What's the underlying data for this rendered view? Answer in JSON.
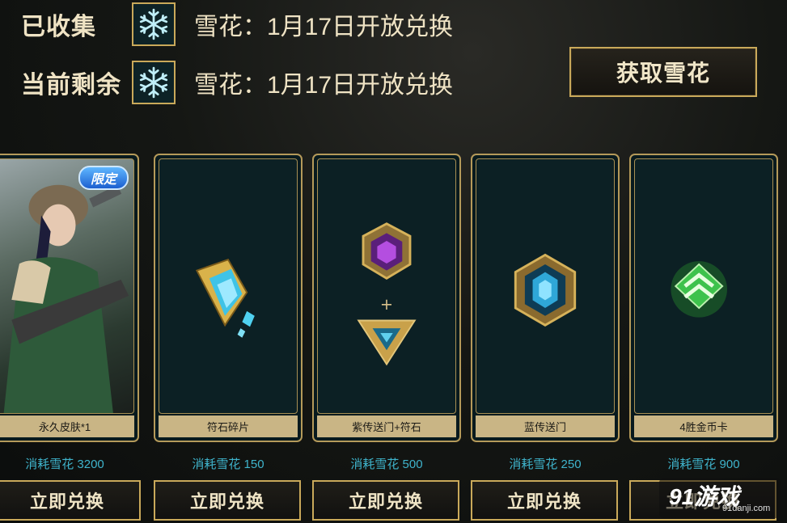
{
  "header": {
    "collected_label": "已收集",
    "remaining_label": "当前剩余",
    "collected_text": "雪花：1月17日开放兑换",
    "remaining_text": "雪花：1月17日开放兑换",
    "snow_icon": "snowflake-icon",
    "get_button_label": "获取雪花"
  },
  "cards": [
    {
      "name": "永久皮肤*1",
      "cost": "消耗雪花 3200",
      "button": "立即兑换",
      "badge": "限定",
      "icon": "skin-portrait"
    },
    {
      "name": "符石碎片",
      "cost": "消耗雪花 150",
      "button": "立即兑换",
      "icon": "rune-shard-icon"
    },
    {
      "name": "紫传送门+符石",
      "cost": "消耗雪花 500",
      "button": "立即兑换",
      "icon": "purple-portal-icon"
    },
    {
      "name": "蓝传送门",
      "cost": "消耗雪花 250",
      "button": "立即兑换",
      "icon": "blue-portal-icon"
    },
    {
      "name": "4胜金币卡",
      "cost": "消耗雪花 900",
      "button": "立即兑换",
      "icon": "gold-card-icon"
    }
  ],
  "watermark": {
    "logo": "91游戏",
    "url": "91danji.com"
  },
  "colors": {
    "gold_border": "#c9a95a",
    "cost_text": "#3fb4cc",
    "label_bar": "#c9b585"
  }
}
